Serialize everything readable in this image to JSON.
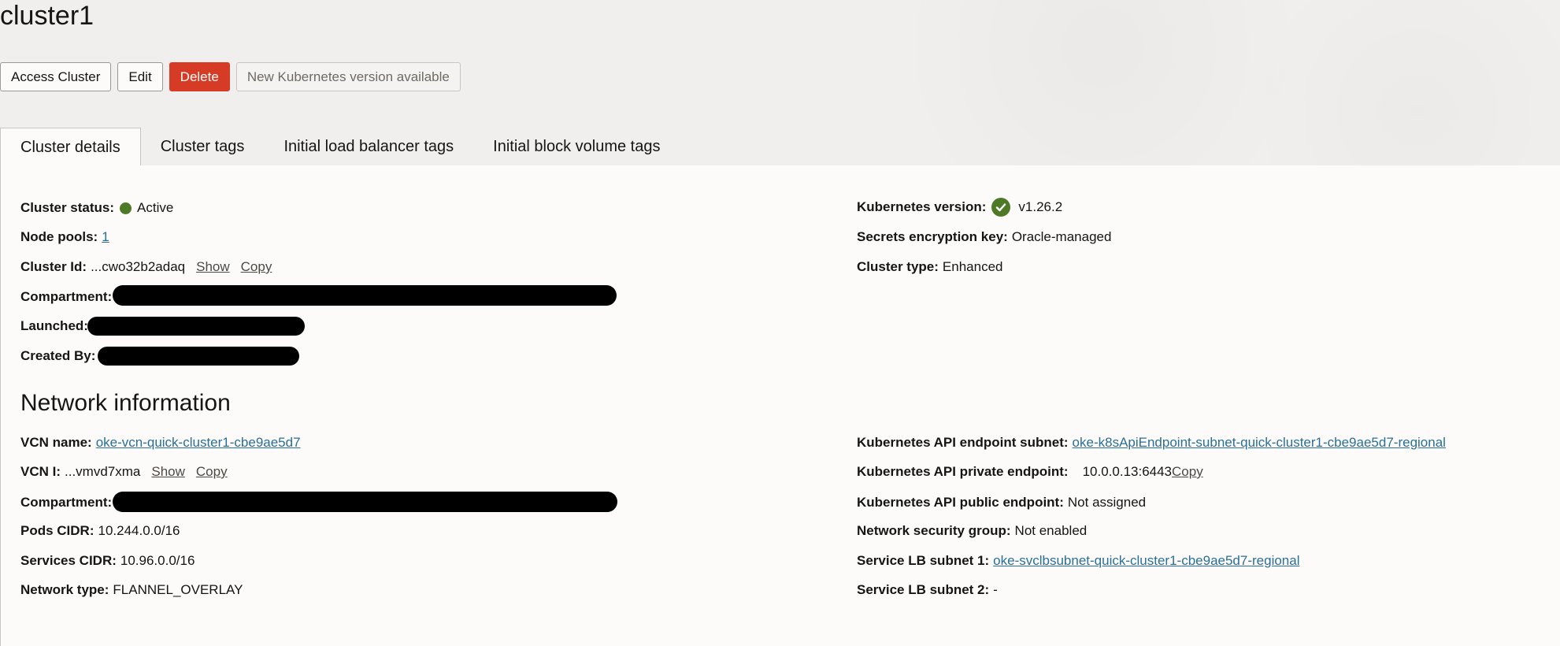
{
  "page": {
    "title": "cluster1"
  },
  "actions": {
    "access_cluster": "Access Cluster",
    "edit": "Edit",
    "delete": "Delete",
    "new_version": "New Kubernetes version available"
  },
  "tabs": [
    {
      "label": "Cluster details",
      "active": true
    },
    {
      "label": "Cluster tags"
    },
    {
      "label": "Initial load balancer tags"
    },
    {
      "label": "Initial block volume tags"
    }
  ],
  "cluster": {
    "status_label": "Cluster status:",
    "status_value": "Active",
    "node_pools_label": "Node pools:",
    "node_pools_value": "1",
    "id_label": "Cluster Id:",
    "id_value": "...cwo32b2adaq",
    "show": "Show",
    "copy": "Copy",
    "compartment_label": "Compartment:",
    "launched_label": "Launched:",
    "created_by_label": "Created By:",
    "k8s_version_label": "Kubernetes version:",
    "k8s_version_value": "v1.26.2",
    "secrets_label": "Secrets encryption key:",
    "secrets_value": "Oracle-managed",
    "type_label": "Cluster type:",
    "type_value": "Enhanced"
  },
  "network": {
    "title": "Network information",
    "vcn_name_label": "VCN name:",
    "vcn_name_value": "oke-vcn-quick-cluster1-cbe9ae5d7",
    "vcn_id_label": "VCN I:",
    "vcn_id_value": "...vmvd7xma",
    "show": "Show",
    "copy": "Copy",
    "compartment_label": "Compartment:",
    "pods_cidr_label": "Pods CIDR:",
    "pods_cidr_value": "10.244.0.0/16",
    "services_cidr_label": "Services CIDR:",
    "services_cidr_value": "10.96.0.0/16",
    "network_type_label": "Network type:",
    "network_type_value": "FLANNEL_OVERLAY",
    "api_subnet_label": "Kubernetes API endpoint subnet:",
    "api_subnet_value": "oke-k8sApiEndpoint-subnet-quick-cluster1-cbe9ae5d7-regional",
    "api_private_label": "Kubernetes API private endpoint:",
    "api_private_value": "10.0.0.13:6443",
    "api_private_copy": "Copy",
    "api_public_label": "Kubernetes API public endpoint:",
    "api_public_value": "Not assigned",
    "nsg_label": "Network security group:",
    "nsg_value": "Not enabled",
    "lb_subnet1_label": "Service LB subnet 1:",
    "lb_subnet1_value": "oke-svclbsubnet-quick-cluster1-cbe9ae5d7-regional",
    "lb_subnet2_label": "Service LB subnet 2:",
    "lb_subnet2_value": "-"
  },
  "colors": {
    "danger": "#d63b25",
    "link": "#2a6f97",
    "status_green": "#4e7a27"
  }
}
